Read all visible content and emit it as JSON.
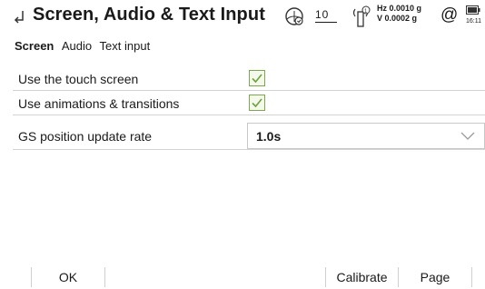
{
  "header": {
    "title": "Screen, Audio & Text Input",
    "back_icon": "back-arrow-icon",
    "status": {
      "ones_value": "10",
      "hz_precision": "Hz 0.0010 g",
      "v_precision": "V  0.0002 g",
      "at_symbol": "@",
      "time": "16:11"
    }
  },
  "tabs": [
    {
      "label": "Screen",
      "active": true
    },
    {
      "label": "Audio",
      "active": false
    },
    {
      "label": "Text input",
      "active": false
    }
  ],
  "settings": {
    "touch_screen": {
      "label": "Use the touch screen",
      "checked": true
    },
    "animations": {
      "label": "Use animations & transitions",
      "checked": true
    },
    "gs_rate": {
      "label": "GS position update rate",
      "value": "1.0s"
    }
  },
  "softkeys": {
    "ok": "OK",
    "calibrate": "Calibrate",
    "page": "Page"
  },
  "colors": {
    "check_green": "#7ca94f",
    "separator": "#d4d4d4"
  }
}
